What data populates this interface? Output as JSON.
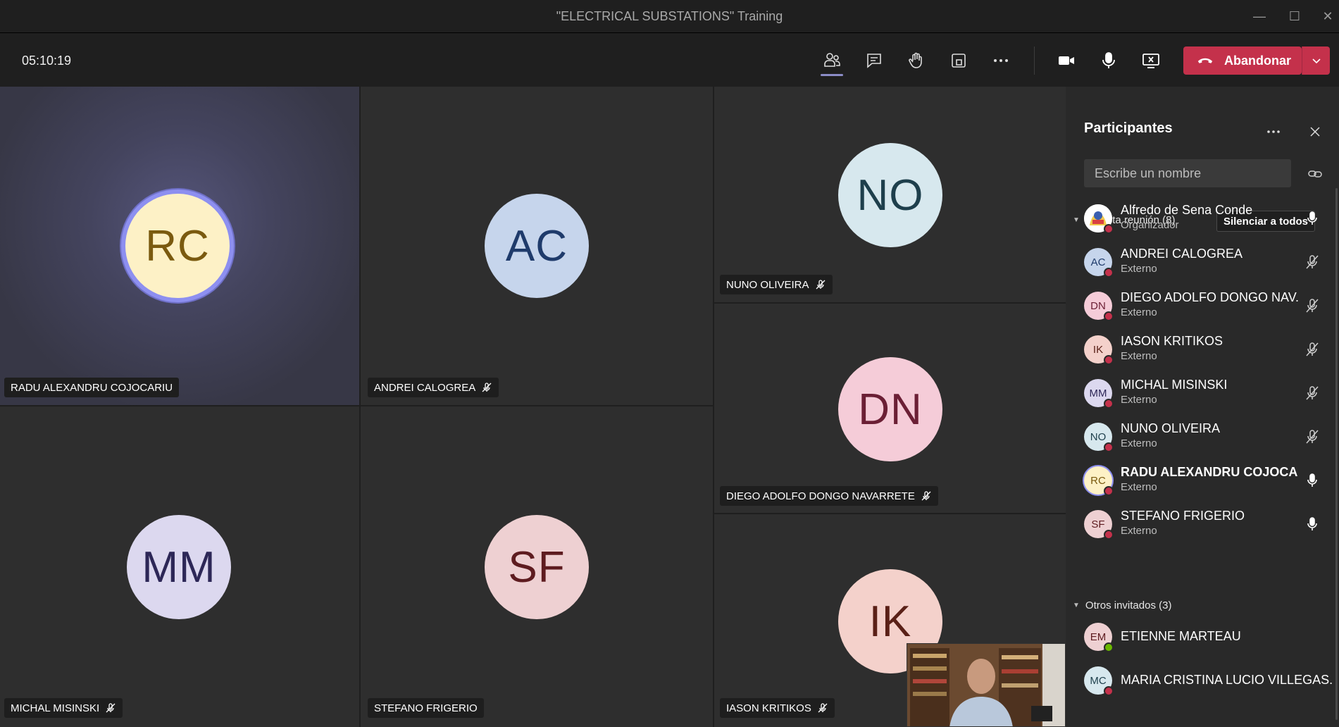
{
  "window": {
    "title": "\"ELECTRICAL SUBSTATIONS\" Training"
  },
  "toolbar": {
    "timer": "05:10:19",
    "leave_label": "Abandonar",
    "icons": [
      "people-icon",
      "chat-icon",
      "raise-hand-icon",
      "room-icon",
      "more-icon",
      "camera-icon",
      "mic-icon",
      "share-screen-icon",
      "hangup-icon",
      "chevron-down-icon"
    ]
  },
  "tiles": [
    {
      "initials": "RC",
      "name": "RADU ALEXANDRU COJOCARIU",
      "muted": false,
      "speaking": true,
      "bg": "#fdf1c6",
      "fg": "#7a5a0f"
    },
    {
      "initials": "AC",
      "name": "ANDREI CALOGREA",
      "muted": true,
      "bg": "#c6d5ec",
      "fg": "#1f3b6b"
    },
    {
      "initials": "NO",
      "name": "NUNO OLIVEIRA",
      "muted": true,
      "bg": "#d7e8ee",
      "fg": "#1e3f4c"
    },
    {
      "initials": "DN",
      "name": "DIEGO ADOLFO DONGO NAVARRETE",
      "muted": true,
      "bg": "#f5ccd8",
      "fg": "#6b1f35"
    },
    {
      "initials": "MM",
      "name": "MICHAL MISINSKI",
      "muted": true,
      "bg": "#dcd8ef",
      "fg": "#2d2757"
    },
    {
      "initials": "SF",
      "name": "STEFANO FRIGERIO",
      "muted": false,
      "bg": "#eed0d2",
      "fg": "#5e1c20"
    },
    {
      "initials": "IK",
      "name": "IASON KRITIKOS",
      "muted": true,
      "bg": "#f4d1cb",
      "fg": "#5a2017"
    }
  ],
  "panel": {
    "title": "Participantes",
    "search_placeholder": "Escribe un nombre",
    "in_meeting_header": "En esta reunión (8)",
    "mute_all": "Silenciar a todos",
    "other_header": "Otros invitados (3)",
    "participants": [
      {
        "initials": "",
        "name": "Alfredo de Sena Conde",
        "role": "Organizador",
        "mic": "on",
        "bg": "#ffffff",
        "fg": "#333"
      },
      {
        "initials": "AC",
        "name": "ANDREI CALOGREA",
        "role": "Externo",
        "mic": "off",
        "bg": "#c6d5ec",
        "fg": "#1f3b6b"
      },
      {
        "initials": "DN",
        "name": "DIEGO ADOLFO DONGO NAV...",
        "role": "Externo",
        "mic": "off",
        "bg": "#f5ccd8",
        "fg": "#6b1f35"
      },
      {
        "initials": "IK",
        "name": "IASON KRITIKOS",
        "role": "Externo",
        "mic": "off",
        "bg": "#f4d1cb",
        "fg": "#5a2017"
      },
      {
        "initials": "MM",
        "name": "MICHAL MISINSKI",
        "role": "Externo",
        "mic": "off",
        "bg": "#dcd8ef",
        "fg": "#2d2757"
      },
      {
        "initials": "NO",
        "name": "NUNO OLIVEIRA",
        "role": "Externo",
        "mic": "off",
        "bg": "#d7e8ee",
        "fg": "#1e3f4c"
      },
      {
        "initials": "RC",
        "name": "RADU ALEXANDRU COJOCA...",
        "role": "Externo",
        "mic": "on",
        "bg": "#fdf1c6",
        "fg": "#7a5a0f",
        "speaking": true
      },
      {
        "initials": "SF",
        "name": "STEFANO FRIGERIO",
        "role": "Externo",
        "mic": "on",
        "bg": "#eed0d2",
        "fg": "#5e1c20"
      }
    ],
    "others": [
      {
        "initials": "EM",
        "name": "ETIENNE MARTEAU",
        "bg": "#eed0d2",
        "fg": "#5e1c20",
        "status": "#6bb700"
      },
      {
        "initials": "MC",
        "name": "MARIA CRISTINA LUCIO VILLEGAS...",
        "bg": "#d7e8ee",
        "fg": "#1e3f4c",
        "status": "#c4314b"
      }
    ]
  },
  "colors": {
    "leave": "#c4314b",
    "accent": "#8b8cc7",
    "status_red": "#c4314b"
  }
}
